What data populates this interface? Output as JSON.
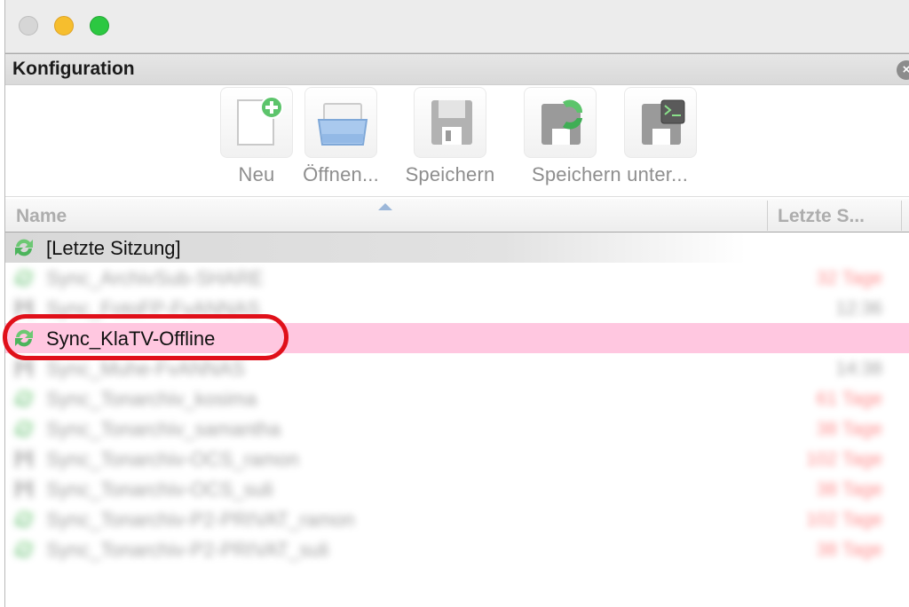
{
  "panel": {
    "title": "Konfiguration",
    "close_glyph": "×"
  },
  "toolbar": {
    "new_label": "Neu",
    "open_label": "Öffnen...",
    "save_label": "Speichern",
    "saveas_label": "Speichern unter..."
  },
  "columns": {
    "name": "Name",
    "last": "Letzte S..."
  },
  "rows": [
    {
      "name": "[Letzte Sitzung]",
      "value": "",
      "icon": "sync-icon",
      "style": "group"
    },
    {
      "name": "Sync_ArchivSub-SHARE",
      "value": "32 Tage",
      "icon": "sync-icon",
      "style": "blurred-red"
    },
    {
      "name": "Sync_FotoFP-FvANNAS",
      "value": "12:36",
      "icon": "disk-icon",
      "style": "blurred-gray"
    },
    {
      "name": "Sync_KlaTV-Offline",
      "value": "",
      "icon": "sync-icon",
      "style": "selected"
    },
    {
      "name": "Sync_Muhe-FvANNAS",
      "value": "14:38",
      "icon": "disk-icon",
      "style": "blurred-gray"
    },
    {
      "name": "Sync_Tonarchiv_kosima",
      "value": "61 Tage",
      "icon": "sync-icon",
      "style": "blurred-red"
    },
    {
      "name": "Sync_Tonarchiv_samantha",
      "value": "38 Tage",
      "icon": "sync-icon",
      "style": "blurred-red"
    },
    {
      "name": "Sync_Tonarchiv-OCS_ramon",
      "value": "102 Tage",
      "icon": "disk-icon",
      "style": "blurred-red"
    },
    {
      "name": "Sync_Tonarchiv-OCS_suli",
      "value": "38 Tage",
      "icon": "disk-icon",
      "style": "blurred-red"
    },
    {
      "name": "Sync_Tonarchiv-P2-PRIVAT_ramon",
      "value": "102 Tage",
      "icon": "sync-icon",
      "style": "blurred-red"
    },
    {
      "name": "Sync_Tonarchiv-P2-PRIVAT_suli",
      "value": "38 Tage",
      "icon": "sync-icon",
      "style": "blurred-red"
    }
  ],
  "colors": {
    "selection": "#ffc7e0",
    "highlight_ring": "#e0101a",
    "stale": "#ff3030"
  }
}
